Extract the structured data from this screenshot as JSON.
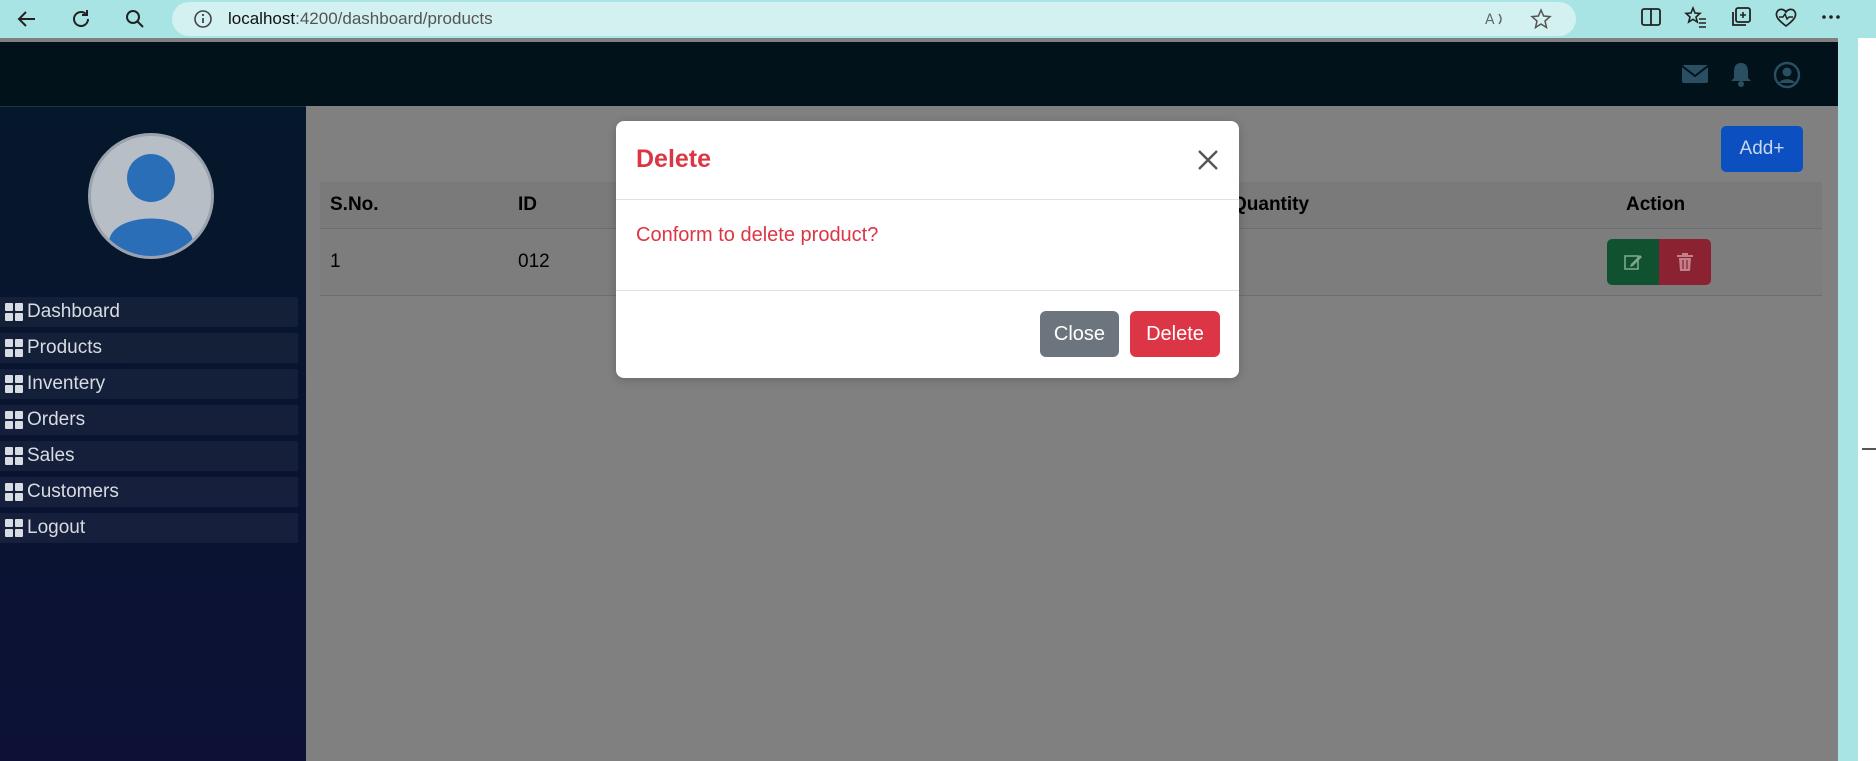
{
  "browser": {
    "url_host": "localhost",
    "url_rest": ":4200/dashboard/products"
  },
  "sidebar": {
    "items": [
      {
        "label": "Dashboard"
      },
      {
        "label": "Products"
      },
      {
        "label": "Inventery"
      },
      {
        "label": "Orders"
      },
      {
        "label": "Sales"
      },
      {
        "label": "Customers"
      },
      {
        "label": "Logout"
      }
    ]
  },
  "content": {
    "add_label": "Add+",
    "table": {
      "headers": [
        "S.No.",
        "ID",
        "Quantity",
        "Action"
      ],
      "rows": [
        {
          "sno": "1",
          "id": "012"
        }
      ]
    }
  },
  "modal": {
    "title": "Delete",
    "message": "Conform to delete product?",
    "close_label": "Close",
    "delete_label": "Delete"
  },
  "colors": {
    "danger": "#dc3545",
    "secondary": "#6c757d",
    "primary": "#0d6efd",
    "success": "#198754",
    "sidebar": "#0a1530"
  }
}
